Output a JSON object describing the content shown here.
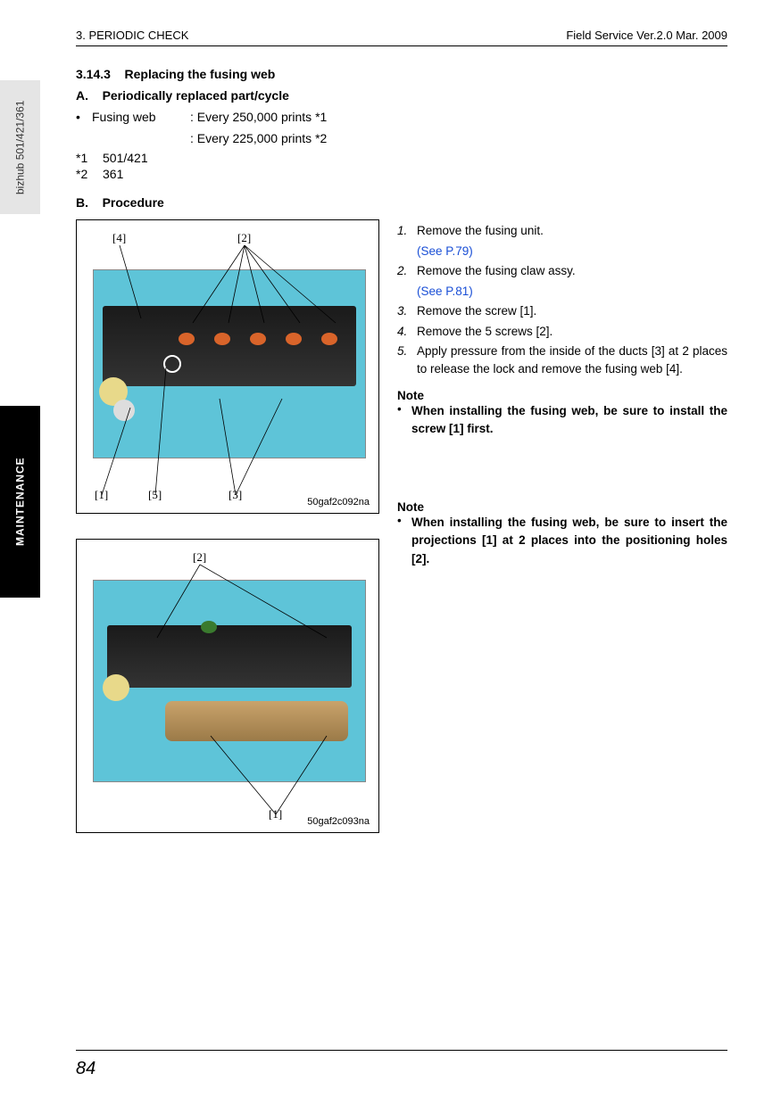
{
  "header": {
    "left": "3. PERIODIC CHECK",
    "right": "Field Service Ver.2.0 Mar. 2009"
  },
  "sideTabs": {
    "model": "bizhub 501/421/361",
    "section": "MAINTENANCE"
  },
  "section": {
    "num": "3.14.3",
    "title": "Replacing the fusing web"
  },
  "partA": {
    "label": "A.",
    "title": "Periodically replaced part/cycle",
    "item": "Fusing web",
    "val1": ": Every 250,000 prints *1",
    "val2": ": Every 225,000 prints *2",
    "fn1mark": "*1",
    "fn1": "501/421",
    "fn2mark": "*2",
    "fn2": "361"
  },
  "partB": {
    "label": "B.",
    "title": "Procedure"
  },
  "fig1": {
    "c1": "[1]",
    "c2": "[2]",
    "c3": "[3]",
    "c4": "[4]",
    "c5": "[5]",
    "code": "50gaf2c092na"
  },
  "fig2": {
    "c1": "[1]",
    "c2": "[2]",
    "code": "50gaf2c093na"
  },
  "steps": {
    "s1n": "1.",
    "s1": "Remove the fusing unit.",
    "s1link": "(See P.79)",
    "s2n": "2.",
    "s2": "Remove the fusing claw assy.",
    "s2link": "(See P.81)",
    "s3n": "3.",
    "s3": "Remove the screw [1].",
    "s4n": "4.",
    "s4": "Remove the 5 screws [2].",
    "s5n": "5.",
    "s5": "Apply pressure from the inside of the ducts [3] at 2 places to release the lock and remove the fusing web [4]."
  },
  "note1": {
    "h": "Note",
    "t": "When installing the fusing web, be sure to install the screw [1] first."
  },
  "note2": {
    "h": "Note",
    "t": "When installing the fusing web, be sure to insert the projections [1] at 2 places into the positioning holes [2]."
  },
  "page": "84"
}
